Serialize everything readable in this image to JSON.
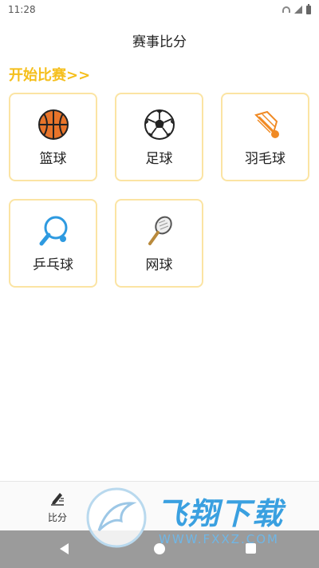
{
  "status_bar": {
    "time": "11:28"
  },
  "header": {
    "title": "赛事比分"
  },
  "start_link": "开始比赛>>",
  "sports": [
    {
      "label": "篮球",
      "icon": "basketball-icon"
    },
    {
      "label": "足球",
      "icon": "soccer-ball-icon"
    },
    {
      "label": "羽毛球",
      "icon": "shuttlecock-icon"
    },
    {
      "label": "乒乓球",
      "icon": "ping-pong-paddle-icon"
    },
    {
      "label": "网球",
      "icon": "tennis-racket-icon"
    }
  ],
  "bottom_nav": {
    "items": [
      {
        "label": "比分",
        "icon": "pencil-note-icon"
      }
    ]
  },
  "watermark": {
    "brand": "飞翔下载",
    "url": "WWW.FXXZ.COM"
  },
  "colors": {
    "accent": "#f5bf1c",
    "card_border": "#fbe4a3"
  }
}
